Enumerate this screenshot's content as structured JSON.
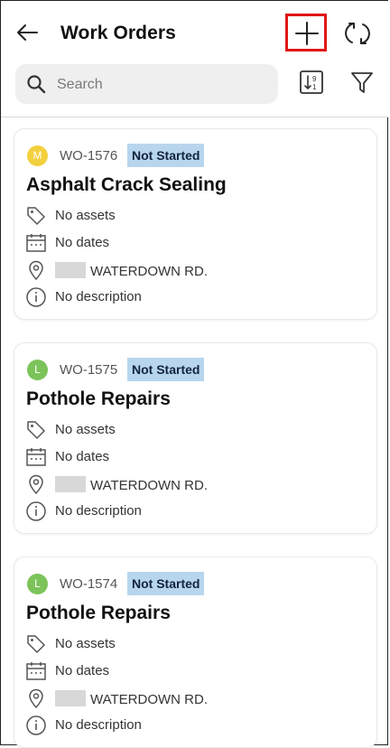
{
  "header": {
    "title": "Work Orders",
    "search_placeholder": "Search"
  },
  "work_orders": [
    {
      "avatar_initial": "M",
      "avatar_color": "#f3d03e",
      "id": "WO-1576",
      "status": "Not Started",
      "title": "Asphalt Crack Sealing",
      "assets": "No assets",
      "dates": "No dates",
      "location": "WATERDOWN RD.",
      "description": "No description"
    },
    {
      "avatar_initial": "L",
      "avatar_color": "#7cc35a",
      "id": "WO-1575",
      "status": "Not Started",
      "title": "Pothole Repairs",
      "assets": "No assets",
      "dates": "No dates",
      "location": "WATERDOWN RD.",
      "description": "No description"
    },
    {
      "avatar_initial": "L",
      "avatar_color": "#7cc35a",
      "id": "WO-1574",
      "status": "Not Started",
      "title": "Pothole Repairs",
      "assets": "No assets",
      "dates": "No dates",
      "location": "WATERDOWN RD.",
      "description": "No description"
    }
  ],
  "colors": {
    "badge_bg": "#b7d6ee",
    "highlight": "#e01616"
  },
  "icons": [
    "back-arrow-icon",
    "plus-icon",
    "sync-icon",
    "search-icon",
    "sort-icon",
    "filter-icon",
    "tag-icon",
    "calendar-icon",
    "location-pin-icon",
    "info-icon"
  ]
}
